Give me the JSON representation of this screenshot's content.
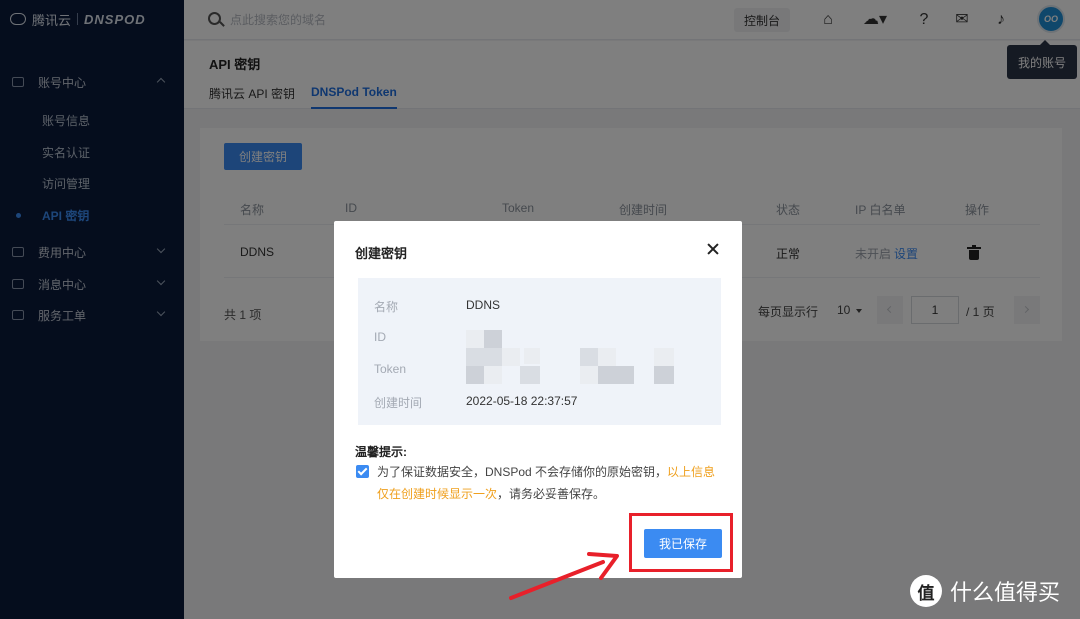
{
  "brand": {
    "company": "腾讯云",
    "product": "DNSPOD"
  },
  "sidebar": {
    "groups": [
      {
        "label": "账号中心",
        "expanded": true
      },
      {
        "label": "费用中心",
        "expanded": false
      },
      {
        "label": "消息中心",
        "expanded": false
      },
      {
        "label": "服务工单",
        "expanded": false
      }
    ],
    "account_items": [
      {
        "label": "账号信息"
      },
      {
        "label": "实名认证"
      },
      {
        "label": "访问管理"
      },
      {
        "label": "API 密钥",
        "active": true
      }
    ]
  },
  "topbar": {
    "search_placeholder": "点此搜索您的域名",
    "console_label": "控制台",
    "icons": [
      "home-icon",
      "cloud-icon",
      "help-icon",
      "wechat-icon",
      "bell-icon"
    ],
    "avatar_text": "OO",
    "account_tooltip": "我的账号"
  },
  "page": {
    "title": "API 密钥",
    "tabs": [
      {
        "label": "腾讯云 API 密钥",
        "active": false
      },
      {
        "label": "DNSPod Token",
        "active": true
      }
    ]
  },
  "table": {
    "create_label": "创建密钥",
    "columns": [
      "名称",
      "ID",
      "Token",
      "创建时间",
      "状态",
      "IP 白名单",
      "操作"
    ],
    "rows": [
      {
        "name": "DDNS",
        "status": "正常",
        "whitelist": "未开启",
        "whitelist_action": "设置",
        "action_icon": "trash-icon"
      }
    ],
    "total_text": "共 1 项",
    "per_page_label": "每页显示行",
    "per_page_value": "10",
    "current_page": "1",
    "total_pages_text": "/ 1 页"
  },
  "modal": {
    "title": "创建密钥",
    "fields": [
      {
        "label": "名称",
        "value": "DDNS"
      },
      {
        "label": "ID",
        "value": ""
      },
      {
        "label": "Token",
        "value": ""
      },
      {
        "label": "创建时间",
        "value": "2022-05-18 22:37:57"
      }
    ],
    "tip_title": "温馨提示:",
    "tip_text": "为了保证数据安全，DNSPod 不会存储你的原始密钥，",
    "tip_warning": "以上信息仅在创建时候显示一次",
    "tip_suffix": "，请务必妥善保存。",
    "confirm_checked": true,
    "save_label": "我已保存"
  },
  "annotation": {
    "highlight_color": "#e8202a"
  },
  "watermark": {
    "badge": "值",
    "text": "什么值得买"
  },
  "colors": {
    "sidebar_bg": "#0a1a3a",
    "accent": "#3b8bf2",
    "warning": "#ef9f1c"
  }
}
